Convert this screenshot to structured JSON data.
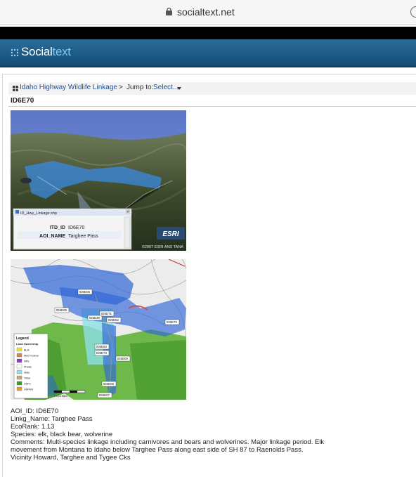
{
  "browser": {
    "url": "socialtext.net"
  },
  "brand": {
    "name_a": "Social",
    "name_b": "text"
  },
  "breadcrumb": {
    "workspace": "Idaho Highway Wildlife Linkage",
    "separator": ">",
    "jump_label": "Jump to:",
    "jump_select": "Select..."
  },
  "page": {
    "title": "ID6E70"
  },
  "image1": {
    "window_title": "ID_Hwy_Linkage.shp",
    "fields": [
      {
        "name": "ITD_ID",
        "value": "ID6E70"
      },
      {
        "name": "AOI_NAME",
        "value": "Targhee Pass"
      }
    ],
    "watermark": "ESRI",
    "copyright": "©2007 ESRI AND TANA"
  },
  "image2": {
    "legend_title": "Legend",
    "legend_subtitle": "Land Ownership",
    "legend_items": [
      {
        "label": "BLM",
        "color": "#f2e33a"
      },
      {
        "label": "Misc Federal",
        "color": "#c98a5a"
      },
      {
        "label": "NPS",
        "color": "#8f3fbf"
      },
      {
        "label": "Private",
        "color": "#ffffff"
      },
      {
        "label": "State",
        "color": "#8fe0e8"
      },
      {
        "label": "Tribal",
        "color": "#c9a77a"
      },
      {
        "label": "USFS",
        "color": "#3f9a2a"
      },
      {
        "label": "USFWS",
        "color": "#e0a030"
      }
    ],
    "scale_label": "0    5    10  Miles",
    "labels": [
      "ID6E05",
      "ID6E06",
      "ID6E71",
      "ID6E39",
      "ID6E62",
      "ID6E72",
      "ID6E60",
      "ID6E73",
      "ID6E00",
      "ID6E06",
      "ID6E07"
    ]
  },
  "details": {
    "aoi_id": "AOI_ID: ID6E70",
    "linkg_name": "Linkg_Name: Targhee Pass",
    "ecorank": "EcoRank: 1.13",
    "species": "Species: elk, black bear, wolverine",
    "comments_1": "Comments: Multi-species linkage including carnivores and bears and wolverines. Major linkage period. Elk",
    "comments_2": "movement from Montana to Idaho below Targhee Pass along east side of SH 87 to Raenolds Pass.",
    "comments_3": "Vicinity Howard, Targhee and Tygee Cks"
  }
}
